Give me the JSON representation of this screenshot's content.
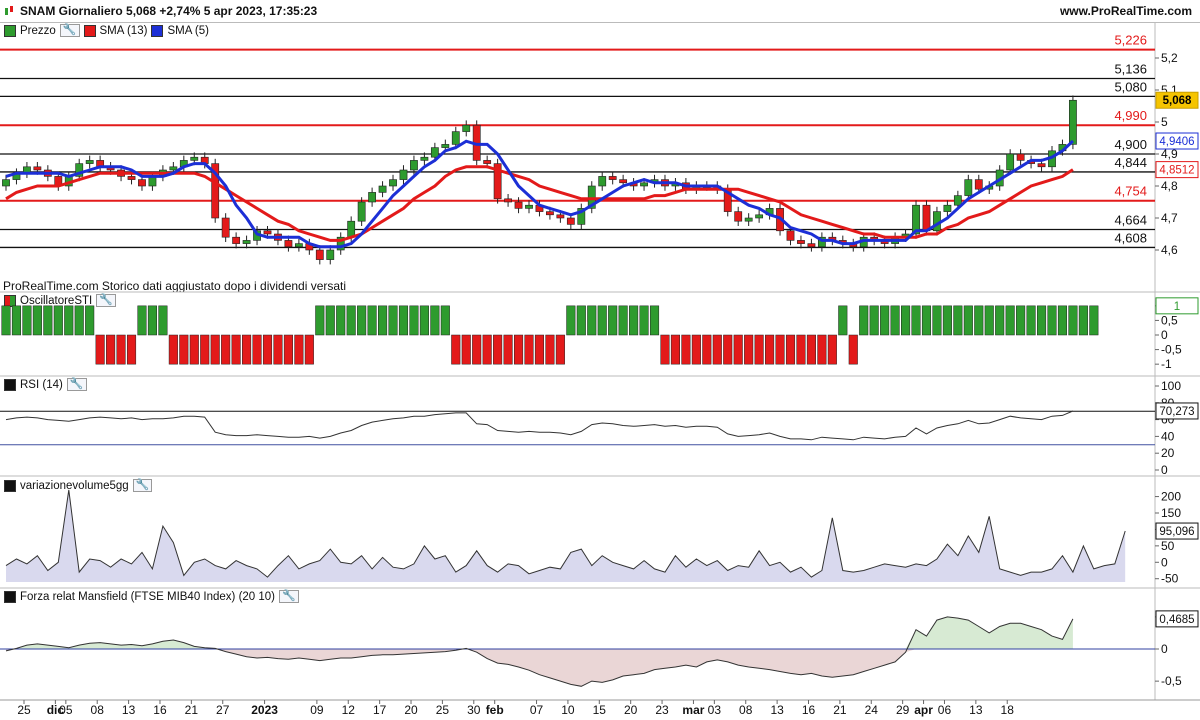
{
  "header": {
    "title": "SNAM Giornaliero 5,068 +2,74% 5 apr 2023, 17:35:23",
    "site": "www.ProRealTime.com"
  },
  "note": "ProRealTime.com Storico dati aggiustato dopo i dividendi versati",
  "colors": {
    "up": "#2e9b2e",
    "down": "#e31a1a",
    "sma13": "#e31a1a",
    "sma5": "#1c2fd6",
    "area": "#d9d9ee",
    "line": "#333333"
  },
  "chart_data": [
    {
      "type": "candlestick",
      "legend": [
        "Prezzo",
        "SMA (13)",
        "SMA (5)"
      ],
      "ylim": [
        4.5,
        5.25
      ],
      "y_ticks": [
        "5,2",
        "5,1",
        "5",
        "4,9",
        "4,8",
        "4,7",
        "4,6"
      ],
      "price_levels": [
        {
          "value": 5.226,
          "label": "5,226",
          "color": "red"
        },
        {
          "value": 5.136,
          "label": "5,136",
          "color": "black"
        },
        {
          "value": 5.08,
          "label": "5,080",
          "color": "black"
        },
        {
          "value": 4.99,
          "label": "4,990",
          "color": "red"
        },
        {
          "value": 4.9,
          "label": "4,900",
          "color": "black"
        },
        {
          "value": 4.844,
          "label": "4,844",
          "color": "black"
        },
        {
          "value": 4.754,
          "label": "4,754",
          "color": "red"
        },
        {
          "value": 4.664,
          "label": "4,664",
          "color": "black"
        },
        {
          "value": 4.608,
          "label": "4,608",
          "color": "black"
        }
      ],
      "last_labels": {
        "price": "5,068",
        "sma5": "4,9406",
        "sma13": "4,8512"
      },
      "close": [
        4.82,
        4.84,
        4.86,
        4.85,
        4.83,
        4.8,
        4.83,
        4.87,
        4.88,
        4.86,
        4.85,
        4.83,
        4.82,
        4.8,
        4.83,
        4.85,
        4.86,
        4.88,
        4.89,
        4.87,
        4.7,
        4.64,
        4.62,
        4.63,
        4.66,
        4.65,
        4.63,
        4.61,
        4.62,
        4.6,
        4.57,
        4.6,
        4.64,
        4.69,
        4.75,
        4.78,
        4.8,
        4.82,
        4.85,
        4.88,
        4.89,
        4.92,
        4.93,
        4.97,
        4.99,
        4.88,
        4.87,
        4.76,
        4.75,
        4.73,
        4.74,
        4.72,
        4.71,
        4.7,
        4.68,
        4.73,
        4.8,
        4.83,
        4.82,
        4.81,
        4.8,
        4.81,
        4.82,
        4.8,
        4.81,
        4.79,
        4.8,
        4.8,
        4.79,
        4.72,
        4.69,
        4.7,
        4.71,
        4.73,
        4.66,
        4.63,
        4.62,
        4.61,
        4.64,
        4.63,
        4.62,
        4.61,
        4.64,
        4.63,
        4.62,
        4.64,
        4.65,
        4.74,
        4.66,
        4.72,
        4.74,
        4.77,
        4.82,
        4.79,
        4.8,
        4.85,
        4.9,
        4.88,
        4.87,
        4.86,
        4.91,
        4.93,
        5.068
      ],
      "sma13": [
        4.76,
        4.78,
        4.79,
        4.8,
        4.8,
        4.8,
        4.81,
        4.82,
        4.83,
        4.84,
        4.84,
        4.84,
        4.84,
        4.84,
        4.84,
        4.84,
        4.84,
        4.84,
        4.84,
        4.83,
        4.81,
        4.79,
        4.77,
        4.75,
        4.73,
        4.71,
        4.69,
        4.68,
        4.66,
        4.65,
        4.64,
        4.63,
        4.63,
        4.64,
        4.65,
        4.67,
        4.69,
        4.71,
        4.73,
        4.76,
        4.78,
        4.8,
        4.83,
        4.85,
        4.86,
        4.86,
        4.86,
        4.85,
        4.84,
        4.83,
        4.82,
        4.8,
        4.79,
        4.78,
        4.77,
        4.76,
        4.76,
        4.76,
        4.76,
        4.76,
        4.76,
        4.76,
        4.77,
        4.77,
        4.78,
        4.79,
        4.79,
        4.79,
        4.79,
        4.79,
        4.79,
        4.78,
        4.77,
        4.76,
        4.75,
        4.73,
        4.71,
        4.7,
        4.69,
        4.68,
        4.67,
        4.66,
        4.65,
        4.65,
        4.64,
        4.64,
        4.64,
        4.64,
        4.65,
        4.65,
        4.67,
        4.68,
        4.7,
        4.71,
        4.72,
        4.74,
        4.76,
        4.78,
        4.8,
        4.81,
        4.82,
        4.83,
        4.8512
      ],
      "sma5": [
        4.83,
        4.84,
        4.84,
        4.84,
        4.84,
        4.84,
        4.83,
        4.84,
        4.85,
        4.86,
        4.86,
        4.86,
        4.85,
        4.83,
        4.83,
        4.83,
        4.84,
        4.86,
        4.87,
        4.87,
        4.84,
        4.8,
        4.74,
        4.7,
        4.65,
        4.64,
        4.64,
        4.64,
        4.64,
        4.62,
        4.61,
        4.61,
        4.61,
        4.62,
        4.65,
        4.69,
        4.73,
        4.77,
        4.8,
        4.83,
        4.86,
        4.88,
        4.91,
        4.92,
        4.94,
        4.93,
        4.93,
        4.9,
        4.85,
        4.8,
        4.77,
        4.74,
        4.73,
        4.72,
        4.71,
        4.72,
        4.74,
        4.76,
        4.78,
        4.8,
        4.81,
        4.82,
        4.81,
        4.81,
        4.81,
        4.8,
        4.8,
        4.8,
        4.8,
        4.78,
        4.76,
        4.74,
        4.73,
        4.71,
        4.7,
        4.67,
        4.66,
        4.65,
        4.63,
        4.63,
        4.62,
        4.62,
        4.63,
        4.63,
        4.63,
        4.63,
        4.63,
        4.66,
        4.66,
        4.68,
        4.7,
        4.73,
        4.76,
        4.78,
        4.8,
        4.82,
        4.84,
        4.86,
        4.88,
        4.88,
        4.89,
        4.91,
        4.9406
      ]
    },
    {
      "type": "histogram",
      "legend": [
        "OscillatoreSTI"
      ],
      "ylim": [
        -1.2,
        1.2
      ],
      "y_ticks": [
        "1",
        "0,5",
        "0",
        "-0,5",
        "-1"
      ],
      "last_label": "1",
      "values": [
        1,
        1,
        1,
        1,
        1,
        1,
        1,
        1,
        1,
        -1,
        -1,
        -1,
        -1,
        1,
        1,
        1,
        -1,
        -1,
        -1,
        -1,
        -1,
        -1,
        -1,
        -1,
        -1,
        -1,
        -1,
        -1,
        -1,
        -1,
        1,
        1,
        1,
        1,
        1,
        1,
        1,
        1,
        1,
        1,
        1,
        1,
        1,
        -1,
        -1,
        -1,
        -1,
        -1,
        -1,
        -1,
        -1,
        -1,
        -1,
        -1,
        1,
        1,
        1,
        1,
        1,
        1,
        1,
        1,
        1,
        -1,
        -1,
        -1,
        -1,
        -1,
        -1,
        -1,
        -1,
        -1,
        -1,
        -1,
        -1,
        -1,
        -1,
        -1,
        -1,
        -1,
        1,
        -1,
        1,
        1,
        1,
        1,
        1,
        1,
        1,
        1,
        1,
        1,
        1,
        1,
        1,
        1,
        1,
        1,
        1,
        1,
        1,
        1,
        1,
        1,
        1
      ]
    },
    {
      "type": "line",
      "legend": [
        "RSI (14)"
      ],
      "ylim": [
        0,
        100
      ],
      "y_ticks": [
        "100",
        "80",
        "60",
        "40",
        "20",
        "0"
      ],
      "levels": [
        70,
        30
      ],
      "last_label": "70,273",
      "values": [
        60,
        62,
        63,
        62,
        60,
        59,
        58,
        60,
        62,
        63,
        62,
        61,
        62,
        60,
        61,
        61,
        62,
        64,
        64,
        63,
        45,
        42,
        41,
        41,
        42,
        41,
        40,
        39,
        39,
        40,
        38,
        40,
        44,
        47,
        53,
        57,
        59,
        61,
        62,
        64,
        64,
        66,
        67,
        68,
        68,
        55,
        54,
        47,
        46,
        45,
        46,
        45,
        45,
        44,
        42,
        46,
        54,
        56,
        55,
        53,
        52,
        53,
        54,
        52,
        53,
        51,
        52,
        52,
        51,
        43,
        40,
        41,
        42,
        44,
        40,
        37,
        37,
        36,
        39,
        38,
        37,
        36,
        39,
        38,
        37,
        39,
        40,
        50,
        43,
        50,
        53,
        55,
        59,
        55,
        56,
        60,
        64,
        62,
        61,
        60,
        64,
        65,
        70.273
      ]
    },
    {
      "type": "area",
      "legend": [
        "variazionevolume5gg"
      ],
      "ylim": [
        -60,
        220
      ],
      "y_ticks": [
        "200",
        "150",
        "100",
        "50",
        "0",
        "-50"
      ],
      "last_label": "95,096",
      "values": [
        -10,
        10,
        -5,
        20,
        -25,
        0,
        220,
        -30,
        10,
        5,
        -15,
        10,
        -5,
        30,
        -20,
        110,
        60,
        -40,
        0,
        10,
        -10,
        -20,
        5,
        -10,
        -20,
        -45,
        -10,
        20,
        -20,
        -5,
        5,
        40,
        0,
        -5,
        20,
        -20,
        15,
        -15,
        -20,
        -5,
        50,
        10,
        20,
        -30,
        -10,
        35,
        -10,
        -30,
        -5,
        -10,
        -35,
        -25,
        -15,
        -20,
        30,
        40,
        -10,
        20,
        0,
        -10,
        -20,
        5,
        -20,
        -30,
        20,
        -15,
        10,
        -10,
        5,
        -25,
        -10,
        -15,
        35,
        -10,
        0,
        -30,
        -15,
        -45,
        -25,
        135,
        -25,
        -30,
        -25,
        -15,
        -5,
        -10,
        -15,
        -5,
        -10,
        10,
        55,
        20,
        80,
        30,
        140,
        -20,
        -30,
        -40,
        -30,
        -30,
        -20,
        20,
        -30,
        50,
        -20,
        -10,
        -5,
        95.096
      ]
    },
    {
      "type": "area",
      "legend": [
        "Forza relat Mansfield (FTSE MIB40 Index) (20 10)"
      ],
      "ylim": [
        -0.7,
        0.7
      ],
      "y_ticks": [
        "0,5",
        "0",
        "-0,5"
      ],
      "last_label": "0,4685",
      "values": [
        -0.03,
        0.01,
        0.06,
        0.08,
        0.06,
        0.04,
        0.02,
        0.06,
        0.09,
        0.1,
        0.08,
        0.06,
        0.07,
        0.05,
        0.08,
        0.12,
        0.14,
        0.1,
        0.04,
        0.02,
        0.01,
        -0.04,
        -0.08,
        -0.12,
        -0.14,
        -0.13,
        -0.15,
        -0.16,
        -0.14,
        -0.16,
        -0.18,
        -0.16,
        -0.14,
        -0.14,
        -0.12,
        -0.1,
        -0.09,
        -0.09,
        -0.08,
        -0.07,
        -0.06,
        -0.05,
        -0.04,
        -0.02,
        0.01,
        -0.05,
        -0.15,
        -0.22,
        -0.24,
        -0.28,
        -0.33,
        -0.4,
        -0.45,
        -0.5,
        -0.55,
        -0.58,
        -0.5,
        -0.52,
        -0.48,
        -0.42,
        -0.4,
        -0.38,
        -0.32,
        -0.3,
        -0.28,
        -0.25,
        -0.28,
        -0.2,
        -0.17,
        -0.2,
        -0.25,
        -0.28,
        -0.3,
        -0.32,
        -0.35,
        -0.38,
        -0.4,
        -0.38,
        -0.42,
        -0.44,
        -0.42,
        -0.4,
        -0.35,
        -0.3,
        -0.25,
        -0.2,
        -0.05,
        0.3,
        0.2,
        0.45,
        0.5,
        0.48,
        0.45,
        0.35,
        0.25,
        0.35,
        0.4,
        0.4,
        0.35,
        0.3,
        0.2,
        0.15,
        0.4685
      ]
    }
  ],
  "x_axis": {
    "labels": [
      {
        "i": 0,
        "text": "25",
        "bold": false
      },
      {
        "i": 3,
        "text": "dic",
        "bold": true
      },
      {
        "i": 4,
        "text": "05",
        "bold": false
      },
      {
        "i": 7,
        "text": "08",
        "bold": false
      },
      {
        "i": 10,
        "text": "13",
        "bold": false
      },
      {
        "i": 13,
        "text": "16",
        "bold": false
      },
      {
        "i": 16,
        "text": "21",
        "bold": false
      },
      {
        "i": 19,
        "text": "27",
        "bold": false
      },
      {
        "i": 23,
        "text": "2023",
        "bold": true
      },
      {
        "i": 28,
        "text": "09",
        "bold": false
      },
      {
        "i": 31,
        "text": "12",
        "bold": false
      },
      {
        "i": 34,
        "text": "17",
        "bold": false
      },
      {
        "i": 37,
        "text": "20",
        "bold": false
      },
      {
        "i": 40,
        "text": "25",
        "bold": false
      },
      {
        "i": 43,
        "text": "30",
        "bold": false
      },
      {
        "i": 45,
        "text": "feb",
        "bold": true
      },
      {
        "i": 49,
        "text": "07",
        "bold": false
      },
      {
        "i": 52,
        "text": "10",
        "bold": false
      },
      {
        "i": 55,
        "text": "15",
        "bold": false
      },
      {
        "i": 58,
        "text": "20",
        "bold": false
      },
      {
        "i": 61,
        "text": "23",
        "bold": false
      },
      {
        "i": 64,
        "text": "mar",
        "bold": true
      },
      {
        "i": 66,
        "text": "03",
        "bold": false
      },
      {
        "i": 69,
        "text": "08",
        "bold": false
      },
      {
        "i": 72,
        "text": "13",
        "bold": false
      },
      {
        "i": 75,
        "text": "16",
        "bold": false
      },
      {
        "i": 78,
        "text": "21",
        "bold": false
      },
      {
        "i": 81,
        "text": "24",
        "bold": false
      },
      {
        "i": 84,
        "text": "29",
        "bold": false
      },
      {
        "i": 86,
        "text": "apr",
        "bold": true
      },
      {
        "i": 88,
        "text": "06",
        "bold": false
      },
      {
        "i": 91,
        "text": "13",
        "bold": false
      },
      {
        "i": 94,
        "text": "18",
        "bold": false
      }
    ]
  }
}
